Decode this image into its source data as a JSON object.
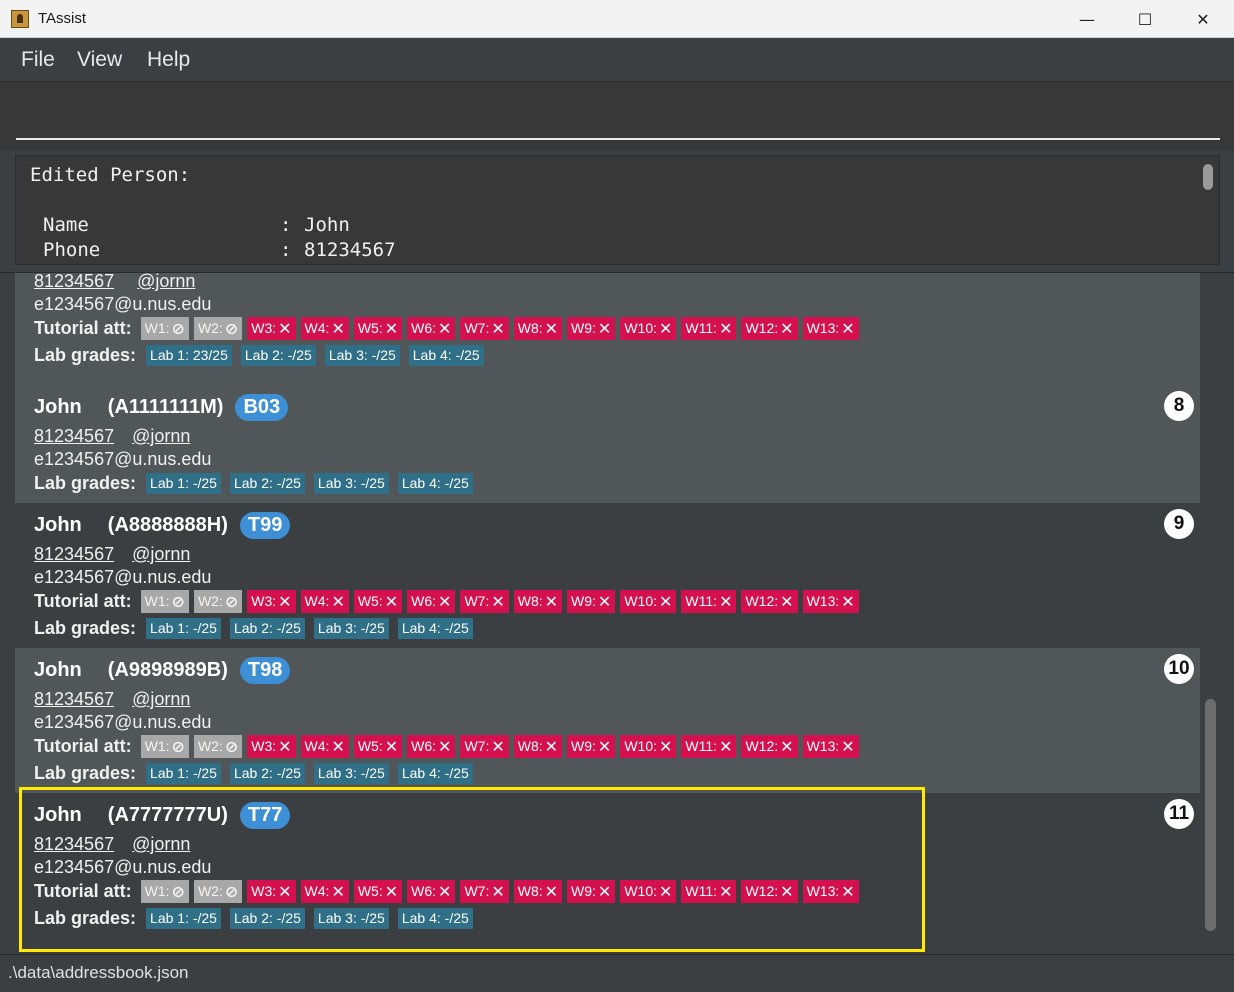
{
  "window": {
    "title": "TAssist",
    "minimize": "—",
    "maximize": "☐",
    "close": "✕"
  },
  "menu": {
    "file": "File",
    "view": "View",
    "help": "Help"
  },
  "command": {
    "value": ""
  },
  "result": {
    "heading": "Edited Person:",
    "name_label": "Name",
    "name_value": "John",
    "phone_label": "Phone",
    "phone_value": "81234567",
    "separator": ":"
  },
  "labels": {
    "tutorial": "Tutorial att:",
    "lab": "Lab grades:"
  },
  "icons": {
    "not_applicable": "not-applicable-icon",
    "absent": "cross-icon"
  },
  "colors": {
    "absent": "#d4114e",
    "not_applicable": "#a8a8a8",
    "lab": "#2f6f87",
    "group": "#3d8fd6",
    "highlight": "#ffea00"
  },
  "partial_card": {
    "phone": "81234567",
    "telegram": "@jornn",
    "email": "e1234567@u.nus.edu",
    "attendance": [
      "W1:",
      "W2:",
      "W3:",
      "W4:",
      "W5:",
      "W6:",
      "W7:",
      "W8:",
      "W9:",
      "W10:",
      "W11:",
      "W12:",
      "W13:"
    ],
    "labs": [
      "Lab 1: 23/25",
      "Lab 2: -/25",
      "Lab 3: -/25",
      "Lab 4: -/25"
    ]
  },
  "persons": [
    {
      "index": "8",
      "name": "John",
      "matric": "(A1111111M)",
      "group": "B03",
      "phone": "81234567",
      "telegram": "@jornn",
      "email": "e1234567@u.nus.edu",
      "attendance": [],
      "labs": [
        "Lab 1: -/25",
        "Lab 2: -/25",
        "Lab 3: -/25",
        "Lab 4: -/25"
      ]
    },
    {
      "index": "9",
      "name": "John",
      "matric": "(A8888888H)",
      "group": "T99",
      "phone": "81234567",
      "telegram": "@jornn",
      "email": "e1234567@u.nus.edu",
      "attendance": [
        "W1:",
        "W2:",
        "W3:",
        "W4:",
        "W5:",
        "W6:",
        "W7:",
        "W8:",
        "W9:",
        "W10:",
        "W11:",
        "W12:",
        "W13:"
      ],
      "labs": [
        "Lab 1: -/25",
        "Lab 2: -/25",
        "Lab 3: -/25",
        "Lab 4: -/25"
      ]
    },
    {
      "index": "10",
      "name": "John",
      "matric": "(A9898989B)",
      "group": "T98",
      "phone": "81234567",
      "telegram": "@jornn",
      "email": "e1234567@u.nus.edu",
      "attendance": [
        "W1:",
        "W2:",
        "W3:",
        "W4:",
        "W5:",
        "W6:",
        "W7:",
        "W8:",
        "W9:",
        "W10:",
        "W11:",
        "W12:",
        "W13:"
      ],
      "labs": [
        "Lab 1: -/25",
        "Lab 2: -/25",
        "Lab 3: -/25",
        "Lab 4: -/25"
      ]
    },
    {
      "index": "11",
      "name": "John",
      "matric": "(A7777777U)",
      "group": "T77",
      "phone": "81234567",
      "telegram": "@jornn",
      "email": "e1234567@u.nus.edu",
      "attendance": [
        "W1:",
        "W2:",
        "W3:",
        "W4:",
        "W5:",
        "W6:",
        "W7:",
        "W8:",
        "W9:",
        "W10:",
        "W11:",
        "W12:",
        "W13:"
      ],
      "labs": [
        "Lab 1: -/25",
        "Lab 2: -/25",
        "Lab 3: -/25",
        "Lab 4: -/25"
      ]
    }
  ],
  "status": {
    "path": ".\\data\\addressbook.json"
  }
}
